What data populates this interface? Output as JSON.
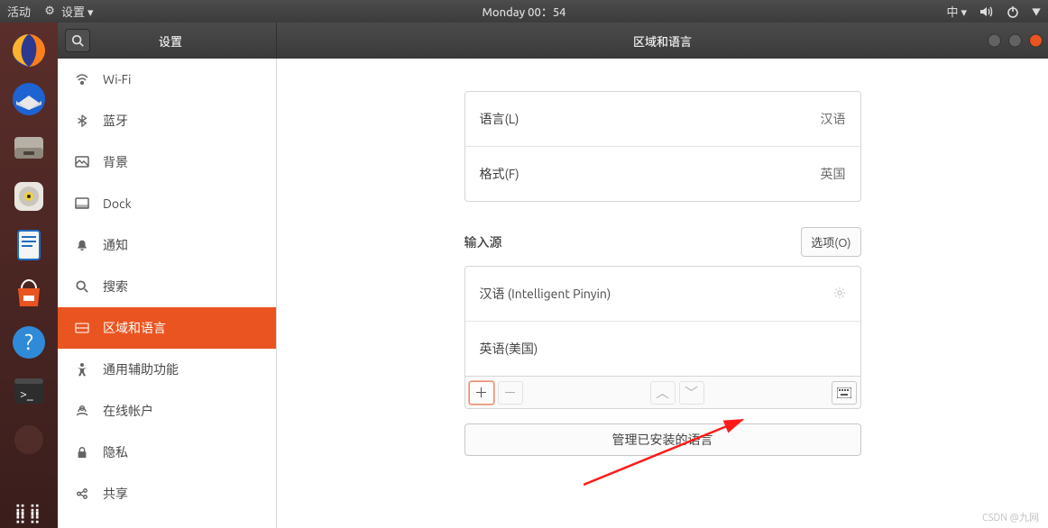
{
  "topbar": {
    "activities": "活动",
    "appmenu": "设置 ▾",
    "clock": "Monday 00：54",
    "ime": "中 ▾"
  },
  "window": {
    "sidebar_title": "设置",
    "header_title": "区域和语言"
  },
  "sidebar": {
    "items": [
      {
        "label": "Wi-Fi",
        "icon": "wifi"
      },
      {
        "label": "蓝牙",
        "icon": "bluetooth"
      },
      {
        "label": "背景",
        "icon": "background"
      },
      {
        "label": "Dock",
        "icon": "dock"
      },
      {
        "label": "通知",
        "icon": "bell"
      },
      {
        "label": "搜索",
        "icon": "search"
      },
      {
        "label": "区域和语言",
        "icon": "globe",
        "active": true
      },
      {
        "label": "通用辅助功能",
        "icon": "a11y"
      },
      {
        "label": "在线帐户",
        "icon": "online"
      },
      {
        "label": "隐私",
        "icon": "lock"
      },
      {
        "label": "共享",
        "icon": "share"
      }
    ]
  },
  "main": {
    "language_row": {
      "label": "语言(L)",
      "value": "汉语"
    },
    "format_row": {
      "label": "格式(F)",
      "value": "英国"
    },
    "input_sources_label": "输入源",
    "options_btn": "选项(O)",
    "inputs": [
      {
        "name": "汉语 (Intelligent Pinyin)",
        "has_prefs": true
      },
      {
        "name": "英语(美国)",
        "has_prefs": false
      }
    ],
    "toolbar": {
      "add": "＋",
      "remove": "－",
      "up": "︿",
      "down": "﹀",
      "keyboard": "⌨"
    },
    "manage_btn": "管理已安装的语言"
  },
  "watermark": "CSDN @九网"
}
